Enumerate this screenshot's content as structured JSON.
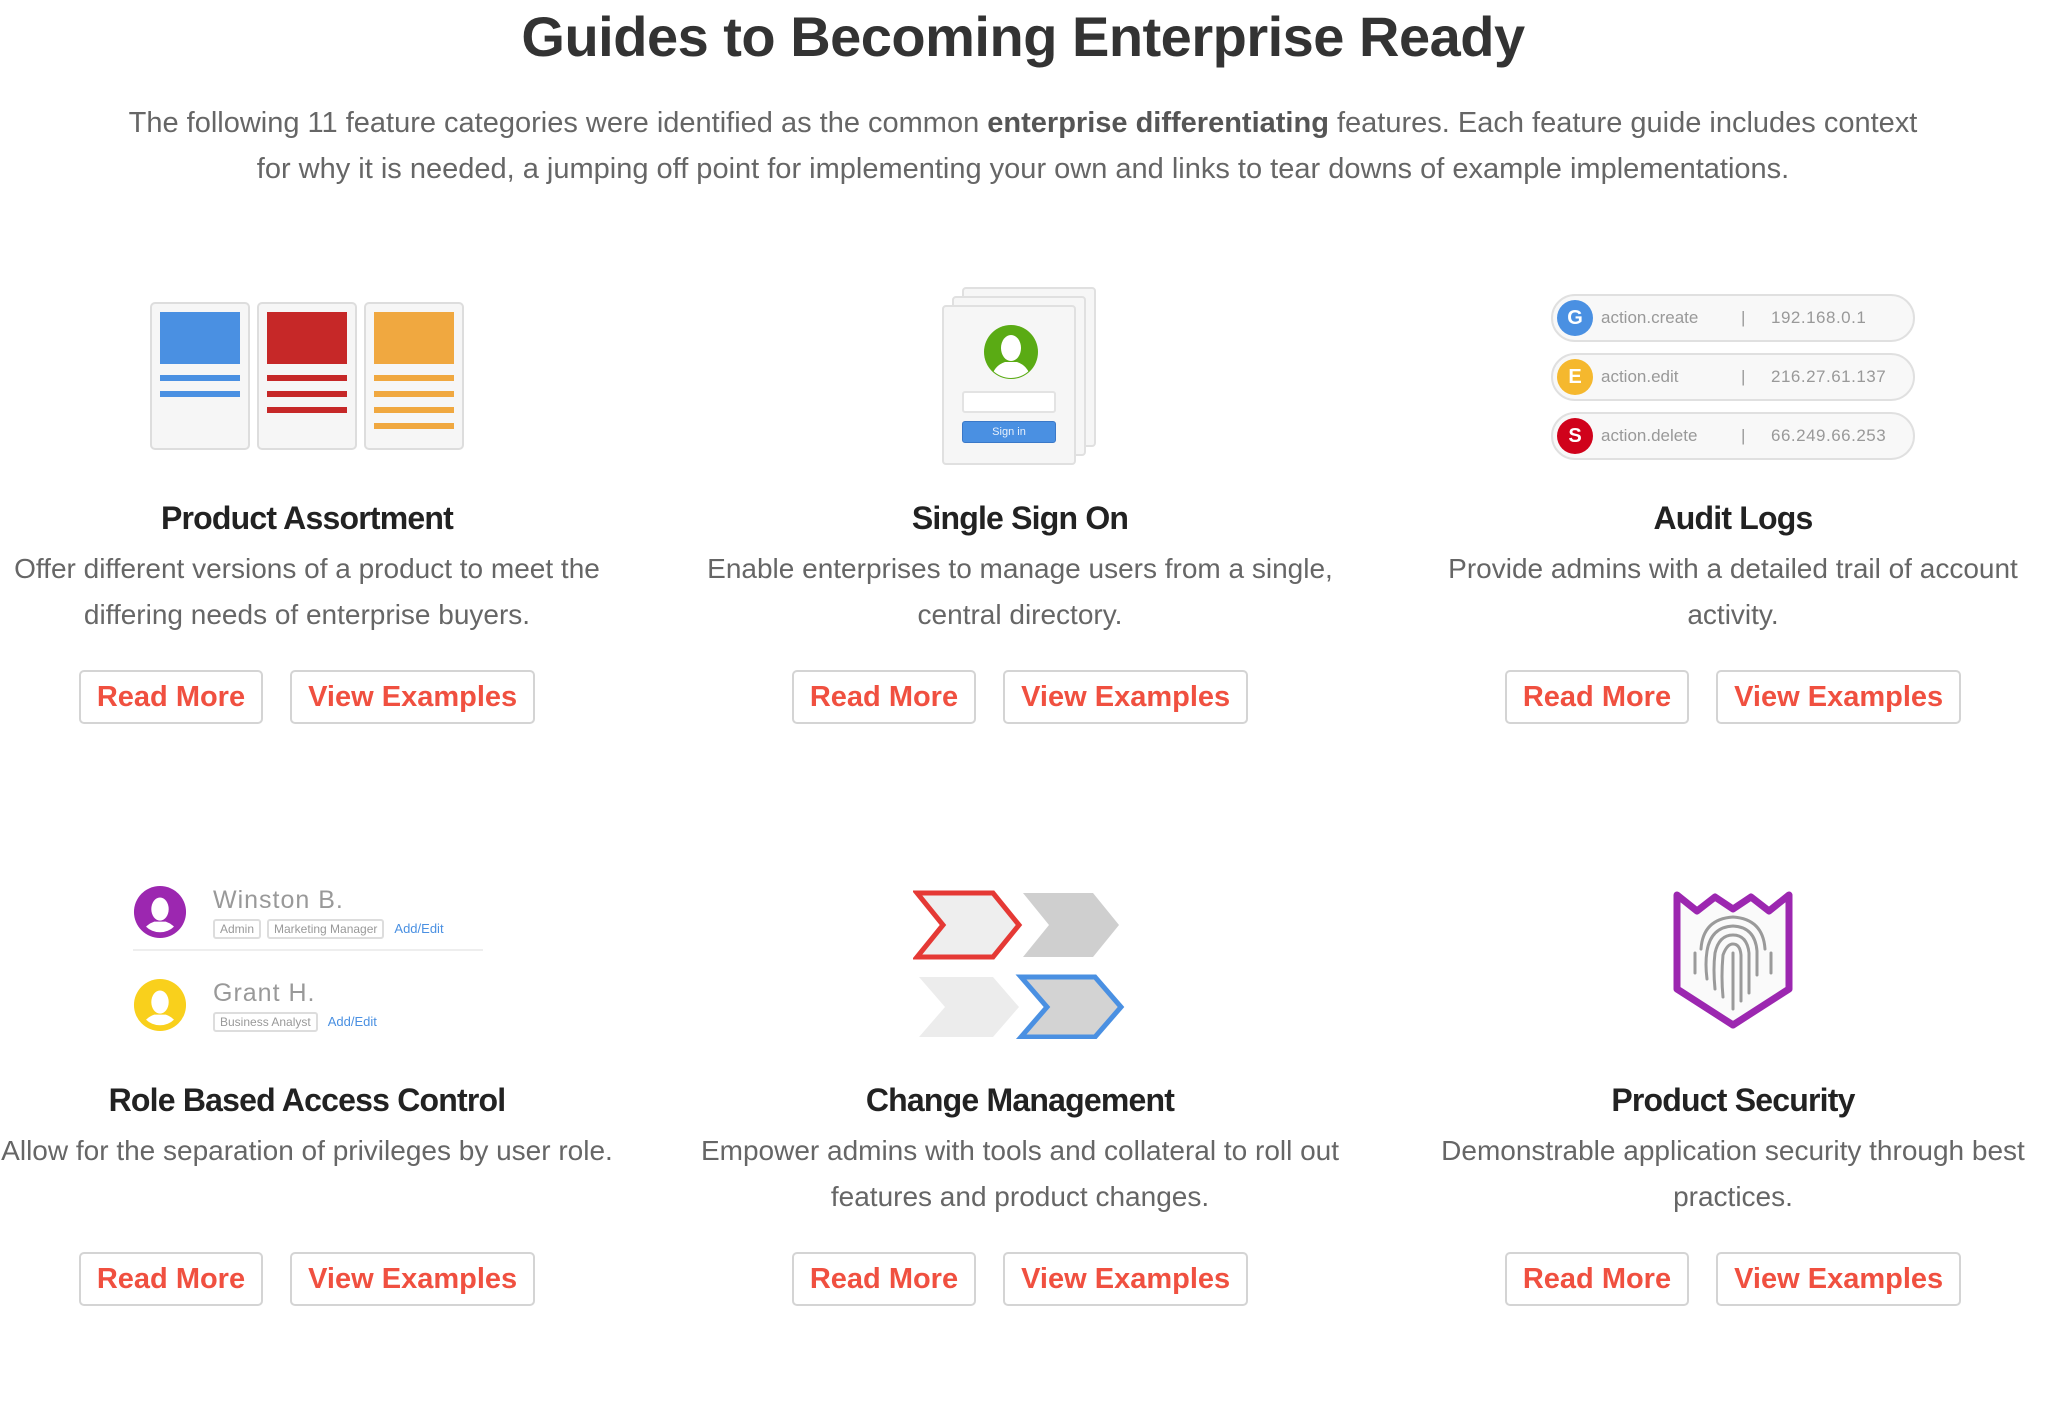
{
  "header": {
    "title": "Guides to Becoming Enterprise Ready",
    "intro_before": "The following 11 feature categories were identified as the common ",
    "intro_bold": "enterprise differentiating",
    "intro_after": " features. Each feature guide includes context for why it is needed, a jumping off point for implementing your own and links to tear downs of example implementations."
  },
  "colors": {
    "accent": "#f05040",
    "blue": "#4a90e2",
    "red": "#c62828",
    "orange": "#f0a840",
    "green": "#5aab14",
    "purple": "#9c27b0",
    "yellow": "#f9d01c"
  },
  "features": [
    {
      "title": "Product Assortment",
      "desc": "Offer different versions of a product to meet the differing needs of enterprise buyers.",
      "read_more": "Read More",
      "view_examples": "View Examples",
      "icon": "product-cards-icon"
    },
    {
      "title": "Single Sign On",
      "desc": "Enable enterprises to manage users from a single, central directory.",
      "read_more": "Read More",
      "view_examples": "View Examples",
      "icon": "sign-in-card-icon",
      "signin_label": "Sign in"
    },
    {
      "title": "Audit Logs",
      "desc": "Provide admins with a detailed trail of account activity.",
      "read_more": "Read More",
      "view_examples": "View Examples",
      "icon": "audit-log-icon",
      "logs": [
        {
          "letter": "G",
          "action": "action.create",
          "sep": "|",
          "ip": "192.168.0.1",
          "color": "#4a90e2"
        },
        {
          "letter": "E",
          "action": "action.edit",
          "sep": "|",
          "ip": "216.27.61.137",
          "color": "#f5b82e"
        },
        {
          "letter": "S",
          "action": "action.delete",
          "sep": "|",
          "ip": "66.249.66.253",
          "color": "#d0021b"
        }
      ]
    },
    {
      "title": "Role Based Access Control",
      "desc": "Allow for the separation of privileges by user role.",
      "read_more": "Read More",
      "view_examples": "View Examples",
      "icon": "user-roles-icon",
      "users": [
        {
          "name": "Winston B.",
          "roles": [
            "Admin",
            "Marketing Manager"
          ],
          "link": "Add/Edit"
        },
        {
          "name": "Grant H.",
          "roles": [
            "Business Analyst"
          ],
          "link": "Add/Edit"
        }
      ]
    },
    {
      "title": "Change Management",
      "desc": "Empower admins with tools and collateral to roll out features and product changes.",
      "read_more": "Read More",
      "view_examples": "View Examples",
      "icon": "chevron-arrows-icon"
    },
    {
      "title": "Product Security",
      "desc": "Demonstrable application security through best practices.",
      "read_more": "Read More",
      "view_examples": "View Examples",
      "icon": "fingerprint-shield-icon"
    }
  ]
}
